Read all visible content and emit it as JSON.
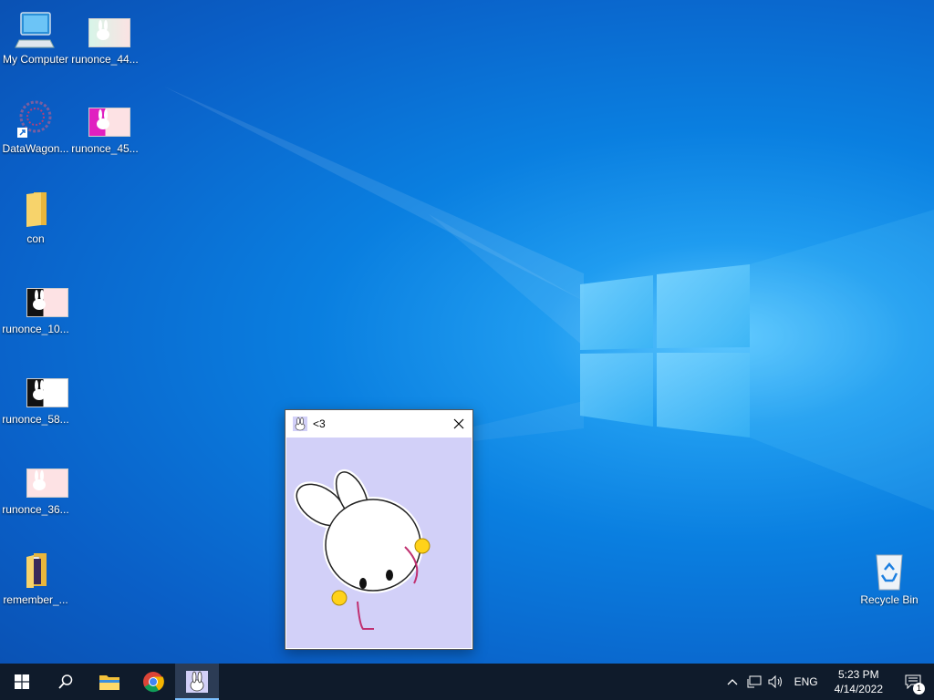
{
  "desktop": {
    "icons": [
      {
        "label": "My Computer"
      },
      {
        "label": "runonce_44..."
      },
      {
        "label": "DataWagon..."
      },
      {
        "label": "runonce_45..."
      },
      {
        "label": "con"
      },
      {
        "label": "runonce_10..."
      },
      {
        "label": "runonce_58..."
      },
      {
        "label": "runonce_36..."
      },
      {
        "label": "remember_..."
      },
      {
        "label": "Recycle Bin"
      }
    ]
  },
  "window": {
    "title": "<3",
    "background_color": "#d2d0f8"
  },
  "taskbar": {
    "language": "ENG",
    "time": "5:23 PM",
    "date": "4/14/2022",
    "notification_count": "1"
  },
  "colors": {
    "taskbar": "#0f1b2b",
    "desktop_accent": "#0a7fe0"
  }
}
